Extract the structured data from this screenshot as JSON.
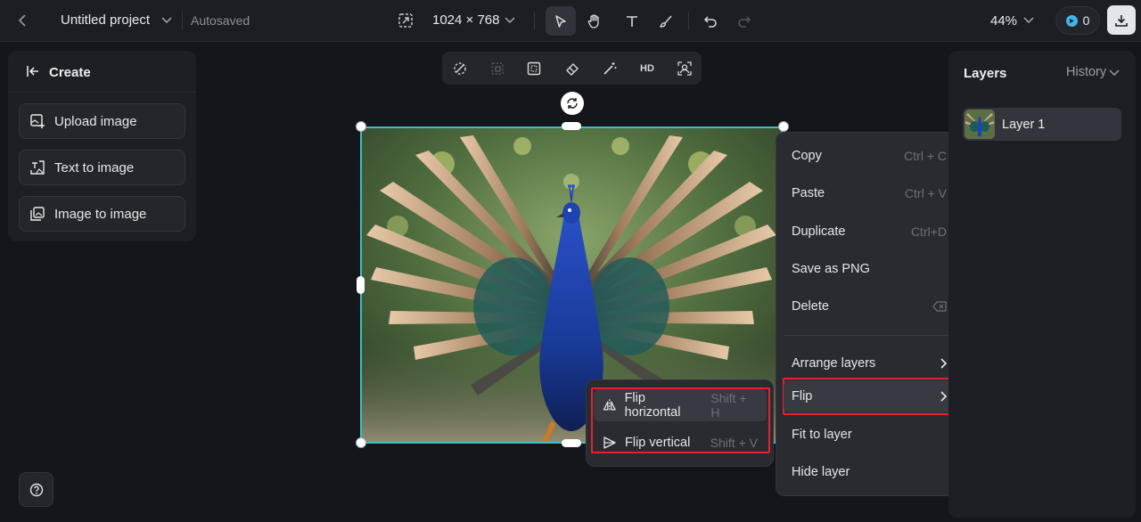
{
  "topbar": {
    "project_title": "Untitled project",
    "autosaved": "Autosaved",
    "canvas_size": "1024 × 768",
    "zoom": "44%",
    "credits": "0"
  },
  "left_panel": {
    "title": "Create",
    "buttons": [
      {
        "label": "Upload image",
        "icon": "upload-image-icon"
      },
      {
        "label": "Text to image",
        "icon": "text-to-image-icon"
      },
      {
        "label": "Image to image",
        "icon": "image-to-image-icon"
      }
    ]
  },
  "image_toolbar": {
    "hd_label": "HD"
  },
  "context_menu": {
    "items": [
      {
        "label": "Copy",
        "shortcut": "Ctrl + C"
      },
      {
        "label": "Paste",
        "shortcut": "Ctrl + V"
      },
      {
        "label": "Duplicate",
        "shortcut": "Ctrl+D"
      },
      {
        "label": "Save as PNG",
        "shortcut": ""
      },
      {
        "label": "Delete",
        "shortcut": ""
      },
      {
        "label": "Arrange layers",
        "shortcut": ""
      },
      {
        "label": "Flip",
        "shortcut": ""
      },
      {
        "label": "Fit to layer",
        "shortcut": ""
      },
      {
        "label": "Hide layer",
        "shortcut": ""
      }
    ]
  },
  "flip_submenu": {
    "items": [
      {
        "label": "Flip horizontal",
        "shortcut": "Shift + H"
      },
      {
        "label": "Flip vertical",
        "shortcut": "Shift + V"
      }
    ]
  },
  "layers_panel": {
    "title": "Layers",
    "history_label": "History",
    "layers": [
      {
        "name": "Layer 1"
      }
    ]
  },
  "colors": {
    "accent_selection": "#3cc0c2",
    "highlight_box": "#e02530",
    "credit_badge": "#3fb6e8"
  }
}
